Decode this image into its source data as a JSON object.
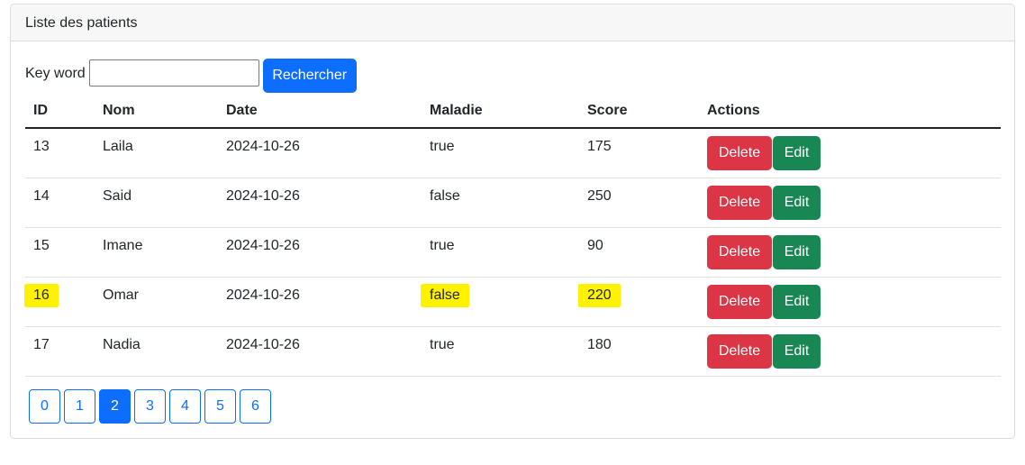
{
  "card": {
    "title": "Liste des patients"
  },
  "search": {
    "label": "Key word",
    "value": "",
    "placeholder": "",
    "button_label": "Rechercher"
  },
  "table": {
    "headers": [
      "ID",
      "Nom",
      "Date",
      "Maladie",
      "Score",
      "Actions"
    ],
    "rows": [
      {
        "id": "13",
        "nom": "Laila",
        "date": "2024-10-26",
        "maladie": "true",
        "score": "175"
      },
      {
        "id": "14",
        "nom": "Said",
        "date": "2024-10-26",
        "maladie": "false",
        "score": "250"
      },
      {
        "id": "15",
        "nom": "Imane",
        "date": "2024-10-26",
        "maladie": "true",
        "score": "90"
      },
      {
        "id": "16",
        "nom": "Omar",
        "date": "2024-10-26",
        "maladie": "false",
        "score": "220"
      },
      {
        "id": "17",
        "nom": "Nadia",
        "date": "2024-10-26",
        "maladie": "true",
        "score": "180"
      }
    ],
    "delete_label": "Delete",
    "edit_label": "Edit"
  },
  "highlight": {
    "color": "#fff200",
    "row_id": "16",
    "fields": [
      "id",
      "maladie",
      "score"
    ]
  },
  "pagination": {
    "pages": [
      "0",
      "1",
      "2",
      "3",
      "4",
      "5",
      "6"
    ],
    "current": "2"
  },
  "colors": {
    "primary": "#0d6efd",
    "danger": "#dc3545",
    "success": "#198754",
    "highlight": "#fff200"
  }
}
